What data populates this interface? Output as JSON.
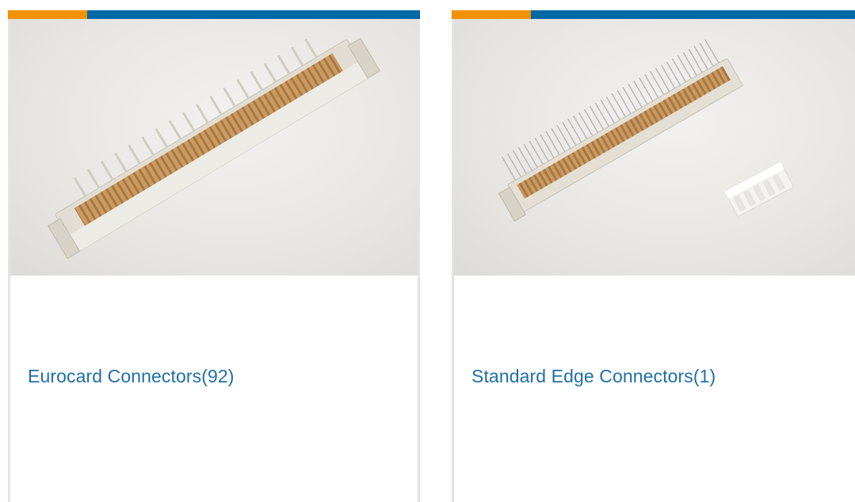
{
  "colors": {
    "accent_orange": "#f39200",
    "accent_blue": "#0068a5",
    "title_blue": "#1f6fa8",
    "card_border": "#e3e3e3"
  },
  "cards": [
    {
      "title": "Eurocard Connectors(92)",
      "image_icon": "eurocard-connector-photo"
    },
    {
      "title": "Standard Edge Connectors(1)",
      "image_icon": "edge-connector-photo"
    }
  ]
}
